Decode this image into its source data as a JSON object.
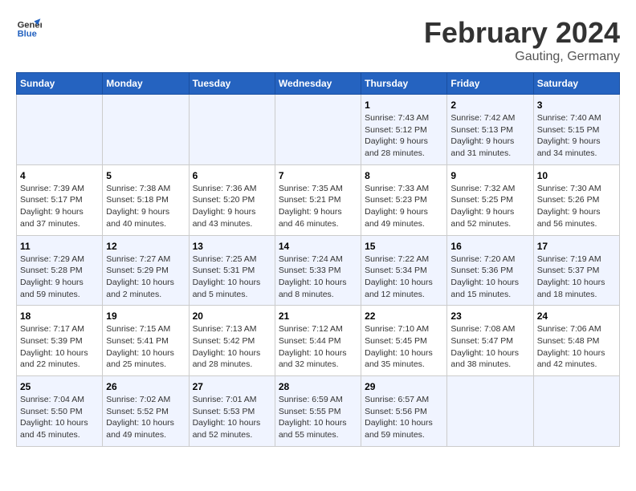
{
  "header": {
    "logo_line1": "General",
    "logo_line2": "Blue",
    "title": "February 2024",
    "subtitle": "Gauting, Germany"
  },
  "days_of_week": [
    "Sunday",
    "Monday",
    "Tuesday",
    "Wednesday",
    "Thursday",
    "Friday",
    "Saturday"
  ],
  "weeks": [
    [
      {
        "day": "",
        "info": ""
      },
      {
        "day": "",
        "info": ""
      },
      {
        "day": "",
        "info": ""
      },
      {
        "day": "",
        "info": ""
      },
      {
        "day": "1",
        "info": "Sunrise: 7:43 AM\nSunset: 5:12 PM\nDaylight: 9 hours\nand 28 minutes."
      },
      {
        "day": "2",
        "info": "Sunrise: 7:42 AM\nSunset: 5:13 PM\nDaylight: 9 hours\nand 31 minutes."
      },
      {
        "day": "3",
        "info": "Sunrise: 7:40 AM\nSunset: 5:15 PM\nDaylight: 9 hours\nand 34 minutes."
      }
    ],
    [
      {
        "day": "4",
        "info": "Sunrise: 7:39 AM\nSunset: 5:17 PM\nDaylight: 9 hours\nand 37 minutes."
      },
      {
        "day": "5",
        "info": "Sunrise: 7:38 AM\nSunset: 5:18 PM\nDaylight: 9 hours\nand 40 minutes."
      },
      {
        "day": "6",
        "info": "Sunrise: 7:36 AM\nSunset: 5:20 PM\nDaylight: 9 hours\nand 43 minutes."
      },
      {
        "day": "7",
        "info": "Sunrise: 7:35 AM\nSunset: 5:21 PM\nDaylight: 9 hours\nand 46 minutes."
      },
      {
        "day": "8",
        "info": "Sunrise: 7:33 AM\nSunset: 5:23 PM\nDaylight: 9 hours\nand 49 minutes."
      },
      {
        "day": "9",
        "info": "Sunrise: 7:32 AM\nSunset: 5:25 PM\nDaylight: 9 hours\nand 52 minutes."
      },
      {
        "day": "10",
        "info": "Sunrise: 7:30 AM\nSunset: 5:26 PM\nDaylight: 9 hours\nand 56 minutes."
      }
    ],
    [
      {
        "day": "11",
        "info": "Sunrise: 7:29 AM\nSunset: 5:28 PM\nDaylight: 9 hours\nand 59 minutes."
      },
      {
        "day": "12",
        "info": "Sunrise: 7:27 AM\nSunset: 5:29 PM\nDaylight: 10 hours\nand 2 minutes."
      },
      {
        "day": "13",
        "info": "Sunrise: 7:25 AM\nSunset: 5:31 PM\nDaylight: 10 hours\nand 5 minutes."
      },
      {
        "day": "14",
        "info": "Sunrise: 7:24 AM\nSunset: 5:33 PM\nDaylight: 10 hours\nand 8 minutes."
      },
      {
        "day": "15",
        "info": "Sunrise: 7:22 AM\nSunset: 5:34 PM\nDaylight: 10 hours\nand 12 minutes."
      },
      {
        "day": "16",
        "info": "Sunrise: 7:20 AM\nSunset: 5:36 PM\nDaylight: 10 hours\nand 15 minutes."
      },
      {
        "day": "17",
        "info": "Sunrise: 7:19 AM\nSunset: 5:37 PM\nDaylight: 10 hours\nand 18 minutes."
      }
    ],
    [
      {
        "day": "18",
        "info": "Sunrise: 7:17 AM\nSunset: 5:39 PM\nDaylight: 10 hours\nand 22 minutes."
      },
      {
        "day": "19",
        "info": "Sunrise: 7:15 AM\nSunset: 5:41 PM\nDaylight: 10 hours\nand 25 minutes."
      },
      {
        "day": "20",
        "info": "Sunrise: 7:13 AM\nSunset: 5:42 PM\nDaylight: 10 hours\nand 28 minutes."
      },
      {
        "day": "21",
        "info": "Sunrise: 7:12 AM\nSunset: 5:44 PM\nDaylight: 10 hours\nand 32 minutes."
      },
      {
        "day": "22",
        "info": "Sunrise: 7:10 AM\nSunset: 5:45 PM\nDaylight: 10 hours\nand 35 minutes."
      },
      {
        "day": "23",
        "info": "Sunrise: 7:08 AM\nSunset: 5:47 PM\nDaylight: 10 hours\nand 38 minutes."
      },
      {
        "day": "24",
        "info": "Sunrise: 7:06 AM\nSunset: 5:48 PM\nDaylight: 10 hours\nand 42 minutes."
      }
    ],
    [
      {
        "day": "25",
        "info": "Sunrise: 7:04 AM\nSunset: 5:50 PM\nDaylight: 10 hours\nand 45 minutes."
      },
      {
        "day": "26",
        "info": "Sunrise: 7:02 AM\nSunset: 5:52 PM\nDaylight: 10 hours\nand 49 minutes."
      },
      {
        "day": "27",
        "info": "Sunrise: 7:01 AM\nSunset: 5:53 PM\nDaylight: 10 hours\nand 52 minutes."
      },
      {
        "day": "28",
        "info": "Sunrise: 6:59 AM\nSunset: 5:55 PM\nDaylight: 10 hours\nand 55 minutes."
      },
      {
        "day": "29",
        "info": "Sunrise: 6:57 AM\nSunset: 5:56 PM\nDaylight: 10 hours\nand 59 minutes."
      },
      {
        "day": "",
        "info": ""
      },
      {
        "day": "",
        "info": ""
      }
    ]
  ]
}
